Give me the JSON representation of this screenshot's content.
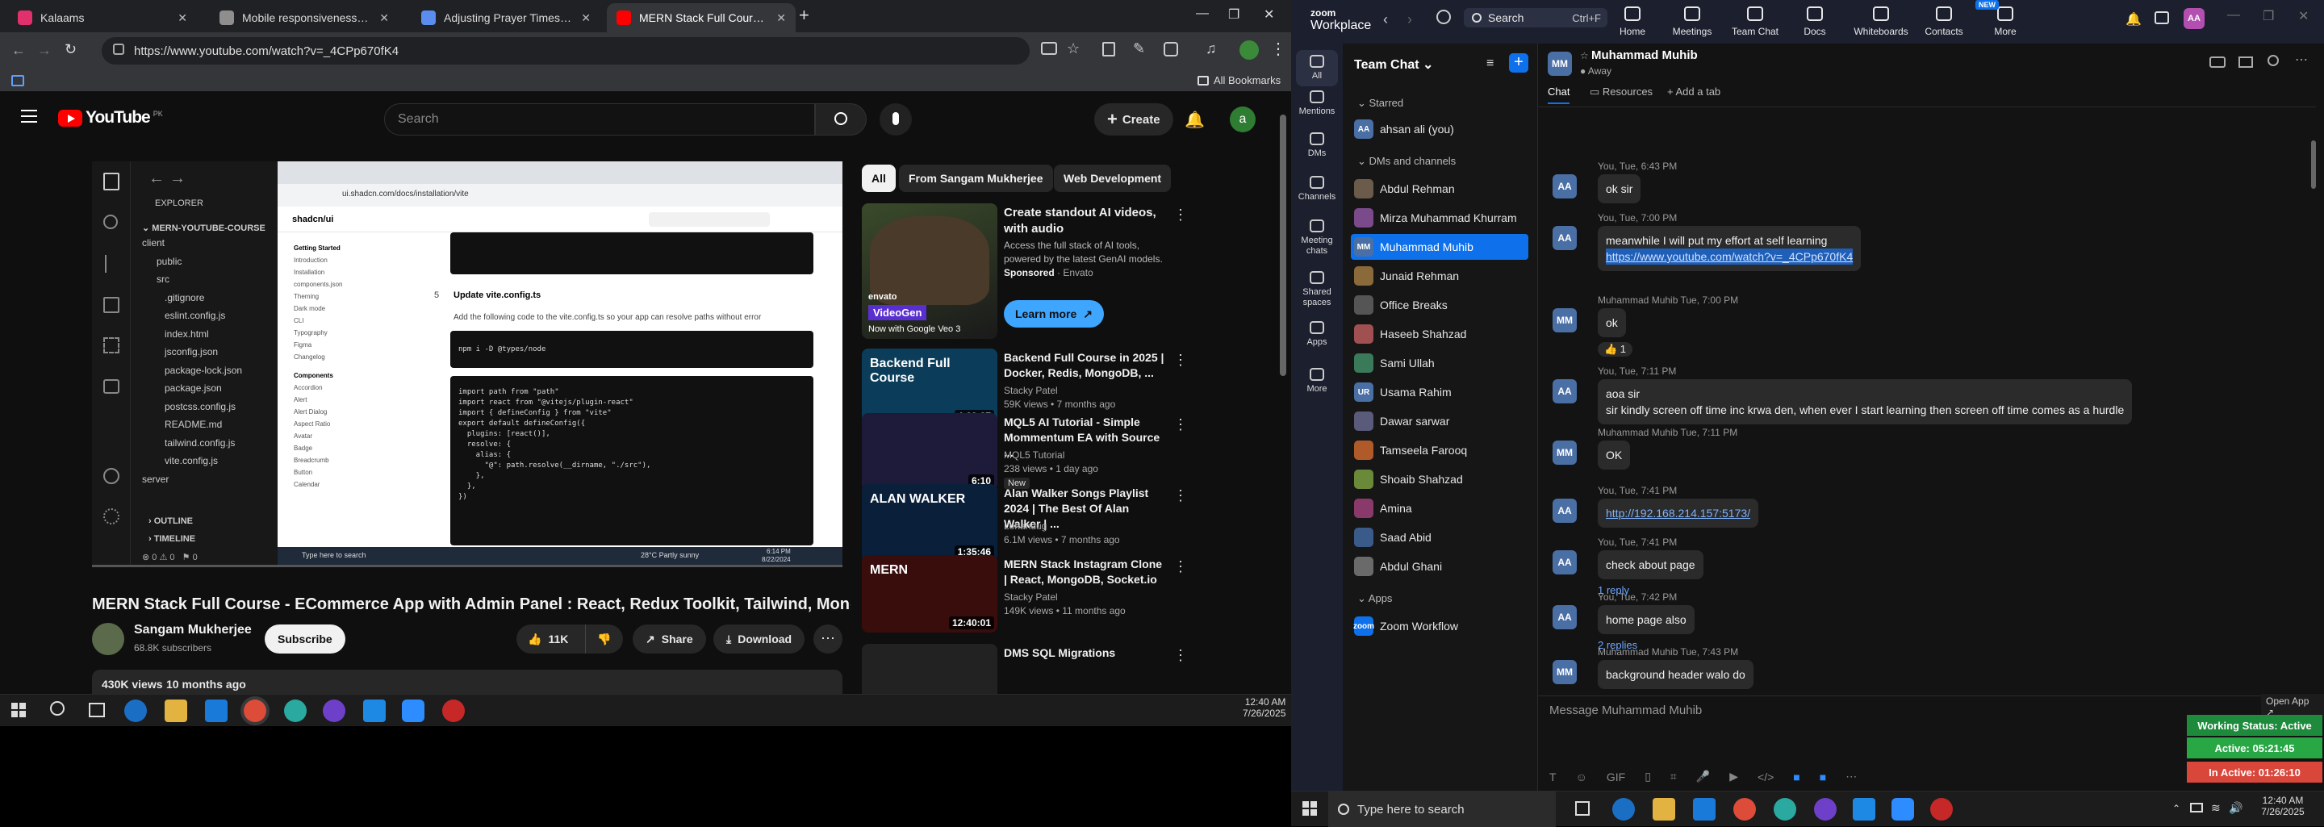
{
  "chrome": {
    "tabs": [
      {
        "title": "Kalaams",
        "fav_color": "#e1306c",
        "active": false
      },
      {
        "title": "Mobile responsiveness fix",
        "fav_color": "#8e8e8e",
        "active": false
      },
      {
        "title": "Adjusting Prayer Times Contai",
        "fav_color": "#5b8def",
        "active": false
      },
      {
        "title": "MERN Stack Full Course - ECom",
        "fav_color": "#ff0000",
        "active": true
      }
    ],
    "url": "https://www.youtube.com/watch?v=_4CPp670fK4",
    "bookmarks_label": "All Bookmarks"
  },
  "youtube": {
    "logo": "YouTube",
    "region": "PK",
    "search_placeholder": "Search",
    "create_label": "Create",
    "avatar_letter": "a",
    "video_title": "MERN Stack Full Course - ECommerce App with Admin Panel : React, Redux Toolkit, Tailwind, MongoDB",
    "channel": "Sangam Mukherjee",
    "subscribers": "68.8K subscribers",
    "subscribe_label": "Subscribe",
    "likes": "11K",
    "share_label": "Share",
    "download_label": "Download",
    "views": "430K views",
    "age": "10 months ago",
    "chips": [
      "All",
      "From Sangam Mukherjee",
      "Web Development"
    ],
    "ad": {
      "title": "Create standout AI videos, with audio",
      "desc": "Access the full stack of AI tools, powered by the latest GenAI models.",
      "sponsored": "Sponsored",
      "advertiser": "Envato",
      "cta": "Learn more",
      "thumb_caption": "Now with Google Veo 3",
      "thumb_brand": "envato",
      "thumb_product": "VideoGen"
    },
    "recs": [
      {
        "title": "Backend Full Course in 2025 | Docker, Redis, MongoDB, ...",
        "channel": "Stacky Patel",
        "meta": "59K views • 7 months ago",
        "dur": "4:29:27",
        "thumb": "#0b3d5a",
        "thumb_text": "Backend Full Course"
      },
      {
        "title": "MQL5 AI Tutorial - Simple Mommentum EA with Source ...",
        "channel": "MQL5 Tutorial",
        "meta": "238 views • 1 day ago",
        "dur": "6:10",
        "badge": "New",
        "thumb": "#1d1a3a",
        "thumb_text": ""
      },
      {
        "title": "Alan Walker Songs Playlist 2024 | The Best Of Alan Walker | ...",
        "channel": "Lohandug",
        "meta": "6.1M views • 7 months ago",
        "dur": "1:35:46",
        "thumb": "#0a1f3a",
        "thumb_text": "ALAN WALKER"
      },
      {
        "title": "MERN Stack Instagram Clone | React, MongoDB, Socket.io",
        "channel": "Stacky Patel",
        "meta": "149K views • 11 months ago",
        "dur": "12:40:01",
        "thumb": "#3a0d0d",
        "thumb_text": "MERN"
      },
      {
        "title": "DMS SQL Migrations",
        "channel": "",
        "meta": "",
        "dur": "",
        "thumb": "#222222",
        "thumb_text": ""
      }
    ],
    "player": {
      "sidebar_title": "EXPLORER",
      "project": "MERN-YOUTUBE-COURSE",
      "files": [
        "client",
        "public",
        "src",
        ".gitignore",
        "eslint.config.js",
        "index.html",
        "jsconfig.json",
        "package-lock.json",
        "package.json",
        "postcss.config.js",
        "README.md",
        "tailwind.config.js",
        "vite.config.js",
        "server"
      ],
      "outline": "OUTLINE",
      "timeline": "TIMELINE",
      "page_url": "ui.shadcn.com/docs/installation/vite",
      "brand": "shadcn/ui",
      "step": "Update vite.config.ts",
      "step_num": "5",
      "desc": "Add the following code to the vite.config.ts so your app can resolve paths without error",
      "nav": [
        "Getting Started",
        "Introduction",
        "Installation",
        "components.json",
        "Theming",
        "Dark mode",
        "CLI",
        "Typography",
        "Figma",
        "Changelog",
        "Components",
        "Accordion",
        "Alert",
        "Alert Dialog",
        "Aspect Ratio",
        "Avatar",
        "Badge",
        "Breadcrumb",
        "Button",
        "Calendar"
      ],
      "code": [
        "import path from \"path\"",
        "import react from \"@vitejs/plugin-react\"",
        "import { defineConfig } from \"vite\"",
        "",
        "export default defineConfig({",
        "  plugins: [react()],",
        "  resolve: {",
        "    alias: {",
        "      \"@\": path.resolve(__dirname, \"./src\"),",
        "    },",
        "  },",
        "})"
      ],
      "cmd": "npm i -D @types/node",
      "weather": "28°C Partly sunny",
      "taskbar_search": "Type here to search",
      "time": "6:14 PM",
      "date": "8/22/2024"
    }
  },
  "left_taskbar": {
    "time": "12:40 AM",
    "date": "7/26/2025"
  },
  "zoom": {
    "brand_top": "zoom",
    "brand_bottom": "Workplace",
    "search_label": "Search",
    "search_shortcut": "Ctrl+F",
    "nav": [
      "Home",
      "Meetings",
      "Team Chat",
      "Docs",
      "Whiteboards",
      "Contacts",
      "More"
    ],
    "new_badge": "NEW",
    "rail": [
      "All",
      "Mentions",
      "DMs",
      "Channels",
      "Meeting chats",
      "Shared spaces",
      "Apps",
      "More"
    ],
    "list_title": "Team Chat",
    "starred_label": "Starred",
    "starred": [
      {
        "name": "ahsan ali (you)",
        "initials": "AA",
        "color": "#4a6fa5"
      }
    ],
    "dms_label": "DMs and channels",
    "dms": [
      {
        "name": "Abdul Rehman",
        "initials": "",
        "color": "#6b5b4b"
      },
      {
        "name": "Mirza Muhammad Khurram",
        "initials": "",
        "color": "#7a4a8a"
      },
      {
        "name": "Muhammad Muhib",
        "initials": "MM",
        "color": "#4a6fa5",
        "selected": true
      },
      {
        "name": "Junaid Rehman",
        "initials": "",
        "color": "#8a6a3a"
      },
      {
        "name": "Office Breaks",
        "initials": "",
        "color": "#555555"
      },
      {
        "name": "Haseeb Shahzad",
        "initials": "",
        "color": "#a05050"
      },
      {
        "name": "Sami Ullah",
        "initials": "",
        "color": "#3a7a5a"
      },
      {
        "name": "Usama Rahim",
        "initials": "UR",
        "color": "#4a6fa5"
      },
      {
        "name": "Dawar sarwar",
        "initials": "",
        "color": "#5a5a7a"
      },
      {
        "name": "Tamseela Farooq",
        "initials": "",
        "color": "#b05a2a"
      },
      {
        "name": "Shoaib Shahzad",
        "initials": "",
        "color": "#6a8a3a"
      },
      {
        "name": "Amina",
        "initials": "",
        "color": "#8a3a6a"
      },
      {
        "name": "Saad Abid",
        "initials": "",
        "color": "#3a5a8a"
      },
      {
        "name": "Abdul Ghani",
        "initials": "",
        "color": "#6a6a6a"
      }
    ],
    "apps_label": "Apps",
    "apps": [
      {
        "name": "Zoom Workflow",
        "initials": "zoom",
        "color": "#0e71eb"
      }
    ],
    "chat_name": "Muhammad Muhib",
    "chat_status": "Away",
    "chat_avatar": "MM",
    "chat_tabs": [
      "Chat",
      "Resources",
      "Add a tab"
    ],
    "messages": [
      {
        "who": "AA",
        "color": "#4a6fa5",
        "header": "You, Tue, 6:43 PM",
        "lines": [
          "ok sir"
        ]
      },
      {
        "who": "AA",
        "color": "#4a6fa5",
        "header": "You, Tue, 7:00 PM",
        "lines": [
          "meanwhile I will put my effort at self learning",
          "https://www.youtube.com/watch?v=_4CPp670fK4"
        ],
        "link_line": 1,
        "highlight": true
      },
      {
        "who": "MM",
        "color": "#4a6fa5",
        "header": "Muhammad Muhib  Tue, 7:00 PM",
        "lines": [
          "ok"
        ],
        "reaction": "👍 1"
      },
      {
        "who": "AA",
        "color": "#4a6fa5",
        "header": "You, Tue, 7:11 PM",
        "lines": [
          "aoa sir",
          "sir kindly screen off time inc krwa den, when ever I start learning then screen off time comes as a hurdle"
        ]
      },
      {
        "who": "MM",
        "color": "#4a6fa5",
        "header": "Muhammad Muhib  Tue, 7:11 PM",
        "lines": [
          "OK"
        ]
      },
      {
        "who": "AA",
        "color": "#4a6fa5",
        "header": "You, Tue, 7:41 PM",
        "lines": [
          "http://192.168.214.157:5173/"
        ],
        "link_line": 0
      },
      {
        "who": "AA",
        "color": "#4a6fa5",
        "header": "You, Tue, 7:41 PM",
        "lines": [
          "check about page"
        ],
        "reply": "1 reply"
      },
      {
        "who": "AA",
        "color": "#4a6fa5",
        "header": "You, Tue, 7:42 PM",
        "lines": [
          "home page also"
        ],
        "reply": "2 replies"
      },
      {
        "who": "MM",
        "color": "#4a6fa5",
        "header": "Muhammad Muhib  Tue, 7:43 PM",
        "lines": [
          "background header walo do"
        ]
      }
    ],
    "open_app": "Open App",
    "composer_placeholder": "Message Muhammad Muhib",
    "working_status": "Working Status: Active",
    "active_time": "Active: 05:21:45",
    "inactive_time": "In Active: 01:26:10",
    "status_colors": {
      "working": "#1e8a3c",
      "active": "#28a745",
      "inactive": "#d9463a"
    }
  },
  "right_taskbar": {
    "search": "Type here to search",
    "time": "12:40 AM",
    "date": "7/26/2025"
  }
}
